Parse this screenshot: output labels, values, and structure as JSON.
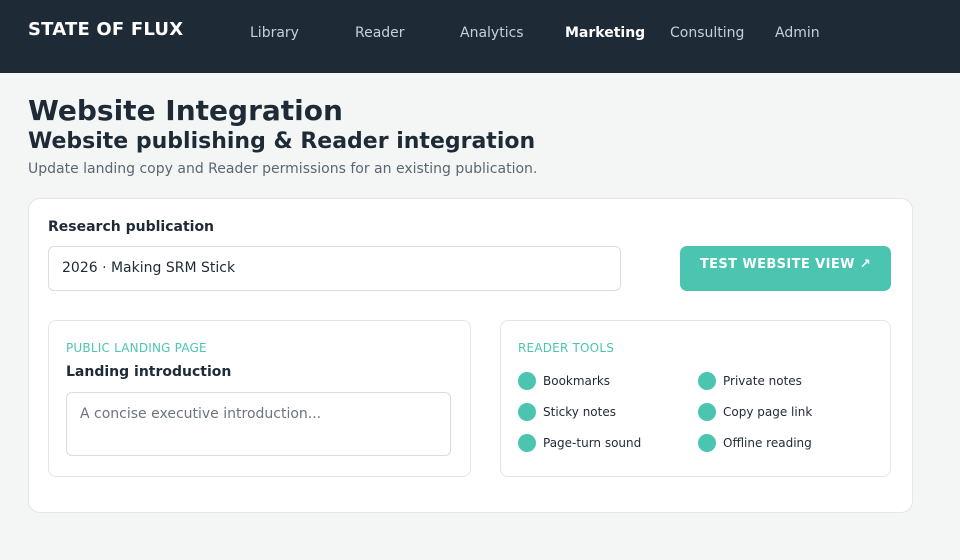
{
  "header": {
    "brand": "STATE OF FLUX",
    "nav": [
      {
        "label": "Library"
      },
      {
        "label": "Reader"
      },
      {
        "label": "Analytics"
      },
      {
        "label": "Marketing"
      },
      {
        "label": "Consulting"
      },
      {
        "label": "Admin"
      }
    ],
    "active_nav": "Marketing"
  },
  "page": {
    "title": "Website Integration",
    "subtitle": "Website publishing & Reader integration",
    "description": "Update landing copy and Reader permissions for an existing publication."
  },
  "publication": {
    "label": "Research publication",
    "value": "2026 · Making SRM Stick"
  },
  "test_button": {
    "label": "TEST WEBSITE VIEW",
    "icon": "external-link-arrow"
  },
  "landing": {
    "eyebrow": "PUBLIC LANDING PAGE",
    "heading": "Landing introduction",
    "placeholder": "A concise executive introduction..."
  },
  "reader_tools": {
    "eyebrow": "READER TOOLS",
    "items": [
      {
        "label": "Bookmarks",
        "enabled": true
      },
      {
        "label": "Private notes",
        "enabled": true
      },
      {
        "label": "Sticky notes",
        "enabled": true
      },
      {
        "label": "Copy page link",
        "enabled": true
      },
      {
        "label": "Page-turn sound",
        "enabled": true
      },
      {
        "label": "Offline reading",
        "enabled": true
      }
    ]
  },
  "colors": {
    "accent": "#4cc5b0",
    "header_bg": "#1f2a37",
    "page_bg": "#f4f6f5"
  }
}
